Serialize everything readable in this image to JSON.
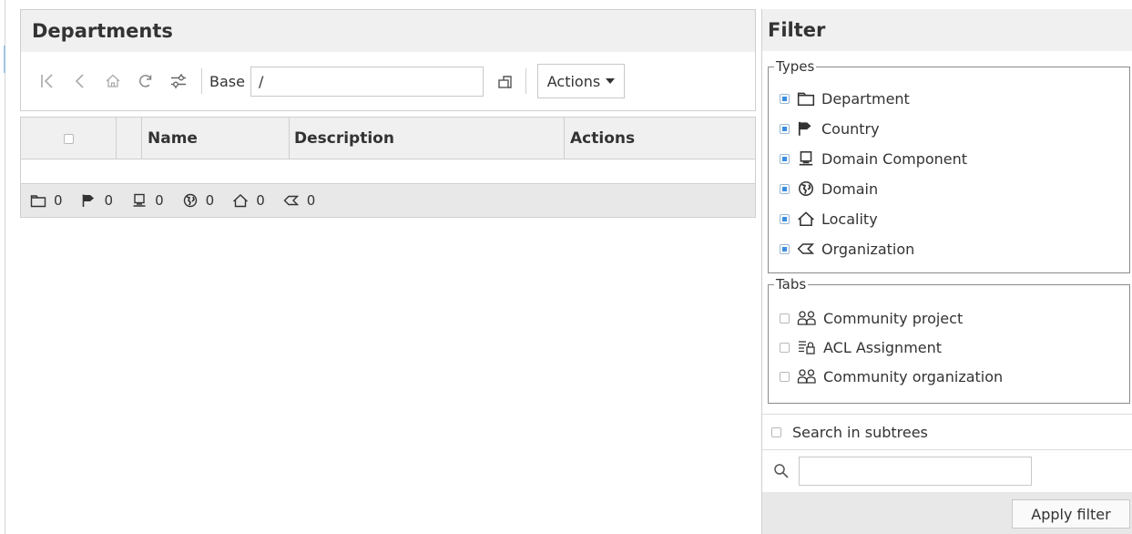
{
  "departments": {
    "title": "Departments",
    "toolbar": {
      "icons": [
        "first-page-icon",
        "back-icon",
        "home-icon",
        "refresh-icon",
        "settings-sliders-icon",
        "select-base-icon"
      ],
      "base_label": "Base",
      "base_value": "/",
      "actions_label": "Actions"
    },
    "grid": {
      "columns": [
        "Name",
        "Description",
        "Actions"
      ],
      "rows": []
    },
    "counts": [
      {
        "icon": "department-icon",
        "value": "0"
      },
      {
        "icon": "country-icon",
        "value": "0"
      },
      {
        "icon": "domain-component-icon",
        "value": "0"
      },
      {
        "icon": "domain-icon",
        "value": "0"
      },
      {
        "icon": "locality-icon",
        "value": "0"
      },
      {
        "icon": "organization-icon",
        "value": "0"
      }
    ]
  },
  "filter": {
    "title": "Filter",
    "types": {
      "legend": "Types",
      "items": [
        {
          "label": "Department",
          "checked": true,
          "icon": "department-icon"
        },
        {
          "label": "Country",
          "checked": true,
          "icon": "country-icon"
        },
        {
          "label": "Domain Component",
          "checked": true,
          "icon": "domain-component-icon"
        },
        {
          "label": "Domain",
          "checked": true,
          "icon": "domain-icon"
        },
        {
          "label": "Locality",
          "checked": true,
          "icon": "locality-icon"
        },
        {
          "label": "Organization",
          "checked": true,
          "icon": "organization-icon"
        }
      ]
    },
    "tabs": {
      "legend": "Tabs",
      "items": [
        {
          "label": "Community project",
          "checked": false,
          "icon": "community-icon"
        },
        {
          "label": "ACL Assignment",
          "checked": false,
          "icon": "acl-icon"
        },
        {
          "label": "Community organization",
          "checked": false,
          "icon": "community-icon"
        }
      ]
    },
    "search_subtrees_label": "Search in subtrees",
    "search_value": "",
    "apply_label": "Apply filter"
  },
  "colors": {
    "checkbox_on": "#3d8ee0",
    "header_bg": "#f0f0f0",
    "footer_bg": "#e8e8e8"
  }
}
